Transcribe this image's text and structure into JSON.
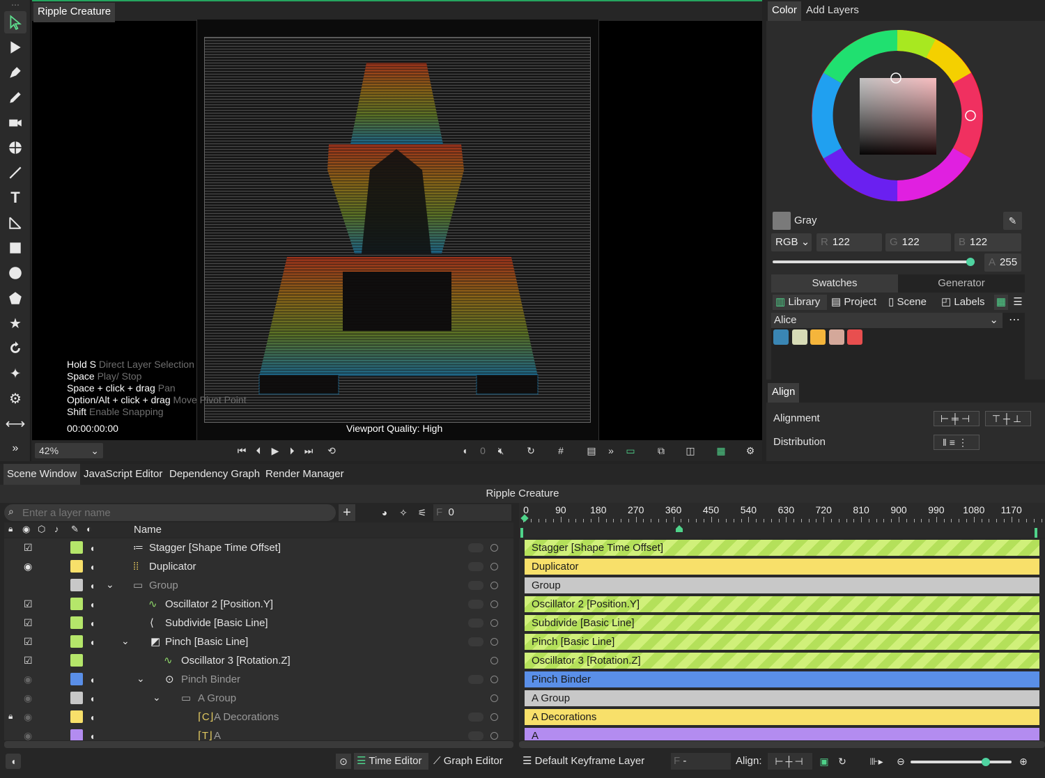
{
  "toolbar": {
    "tools": [
      "more",
      "selection-arrow",
      "direct-select",
      "pen",
      "pencil",
      "camera",
      "orbit",
      "line",
      "text",
      "transform",
      "rectangle",
      "ellipse",
      "polygon",
      "star",
      "rotate",
      "sparkle",
      "settings",
      "resize",
      "expand"
    ]
  },
  "viewer": {
    "tab": "Ripple Creature",
    "hints": [
      {
        "key": "Hold S",
        "desc": "Direct Layer Selection"
      },
      {
        "key": "Space",
        "desc": "Play/ Stop"
      },
      {
        "key": "Space + click + drag",
        "desc": "Pan"
      },
      {
        "key": "Option/Alt + click + drag",
        "desc": "Move Pivot Point"
      },
      {
        "key": "Shift",
        "desc": "Enable Snapping"
      }
    ],
    "timecode": "00:00:00:00",
    "quality": "Viewport Quality: High",
    "zoom": "42%",
    "frame": "0"
  },
  "color": {
    "tabs": [
      "Color",
      "Add Layers"
    ],
    "swatch_name": "Gray",
    "mode": "RGB",
    "r": "122",
    "g": "122",
    "b": "122",
    "a": "255",
    "r_label": "R",
    "g_label": "G",
    "b_label": "B",
    "a_label": "A",
    "alpha_fill": 0.98,
    "subtabs": [
      "Swatches",
      "Generator"
    ],
    "sources": [
      "Library",
      "Project",
      "Scene",
      "Labels"
    ],
    "palette": "Alice",
    "swatches": [
      "#3a86b4",
      "#d7dbb6",
      "#f5b53b",
      "#d4a89a",
      "#e84f4f"
    ]
  },
  "align": {
    "tab": "Align",
    "alignment": "Alignment",
    "distribution": "Distribution"
  },
  "bottom": {
    "tabs": [
      "Scene Window",
      "JavaScript Editor",
      "Dependency Graph",
      "Render Manager"
    ],
    "scene_title": "Ripple Creature",
    "search_placeholder": "Enter a layer name",
    "frame_label": "F",
    "frame_value": "0",
    "name_header": "Name",
    "layers": [
      {
        "name": "Stagger [Shape Time Offset]",
        "color": "#b5e66a",
        "bar": "stripe"
      },
      {
        "name": "Duplicator",
        "color": "#f8e06a",
        "bar": "#f8e06a"
      },
      {
        "name": "Group",
        "color": "#c8c8c8",
        "bar": "#c8c8c8"
      },
      {
        "name": "Oscillator 2 [Position.Y]",
        "color": "#b5e66a",
        "bar": "stripe"
      },
      {
        "name": "Subdivide [Basic Line]",
        "color": "#b5e66a",
        "bar": "stripe"
      },
      {
        "name": "Pinch [Basic Line]",
        "color": "#b5e66a",
        "bar": "stripe"
      },
      {
        "name": "Oscillator 3 [Rotation.Z]",
        "color": "#b5e66a",
        "bar": "stripe"
      },
      {
        "name": "Pinch Binder",
        "color": "#5a8fe8",
        "bar": "#5a8fe8"
      },
      {
        "name": "A Group",
        "color": "#c8c8c8",
        "bar": "#c8c8c8"
      },
      {
        "name": "A Decorations",
        "color": "#f8e06a",
        "bar": "#f8e06a"
      },
      {
        "name": "A",
        "color": "#b38cf0",
        "bar": "#b38cf0"
      }
    ],
    "ticks": [
      "0",
      "90",
      "180",
      "270",
      "360",
      "450",
      "540",
      "630",
      "720",
      "810",
      "900",
      "990",
      "1080",
      "1170"
    ],
    "footer": {
      "time_editor": "Time Editor",
      "graph_editor": "Graph Editor",
      "keyframe_layer": "Default Keyframe Layer",
      "f_label": "F",
      "f_value": "-",
      "align_label": "Align:"
    }
  }
}
